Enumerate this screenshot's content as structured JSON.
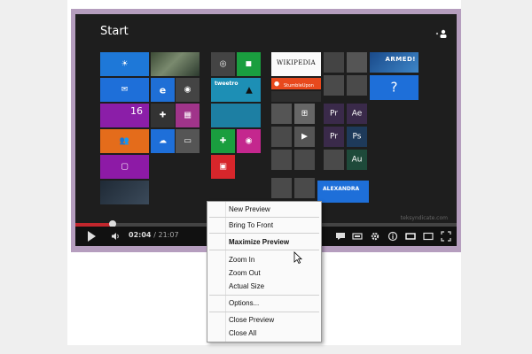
{
  "screen": {
    "title": "Start",
    "watermark": "teksyndicate.com",
    "tile_labels": {
      "wikipedia": "WIKIPEDIA",
      "stumbleupon": "StumbleUpon",
      "tweetro": "tweetro",
      "armed": "ARMED!",
      "alexandra": "ALEXANDRA",
      "date_number": "16",
      "help_glyph": "?"
    },
    "colors": {
      "desktop": "#1e1e1e",
      "blue": "#1e6fd9",
      "green": "#1a9e3f",
      "red": "#d7262b",
      "orange": "#e46c1b",
      "purple": "#8d1aa6",
      "teal": "#1d7fa3"
    }
  },
  "player": {
    "current_time": "02:04",
    "duration": "/ 21:07",
    "progress_fraction": 0.098,
    "accent_color": "#c2272d",
    "controls": [
      "play-icon",
      "volume-icon",
      "captions-icon",
      "annotations-icon",
      "settings-icon",
      "info-icon",
      "small-player-icon",
      "large-player-icon",
      "fullscreen-icon"
    ]
  },
  "context_menu": {
    "items": {
      "new_preview": "New Preview",
      "bring_to_front": "Bring To Front",
      "maximize_preview": "Maximize Preview",
      "zoom_in": "Zoom In",
      "zoom_out": "Zoom Out",
      "actual_size": "Actual Size",
      "options": "Options...",
      "close_preview": "Close Preview",
      "close_all": "Close All"
    }
  }
}
